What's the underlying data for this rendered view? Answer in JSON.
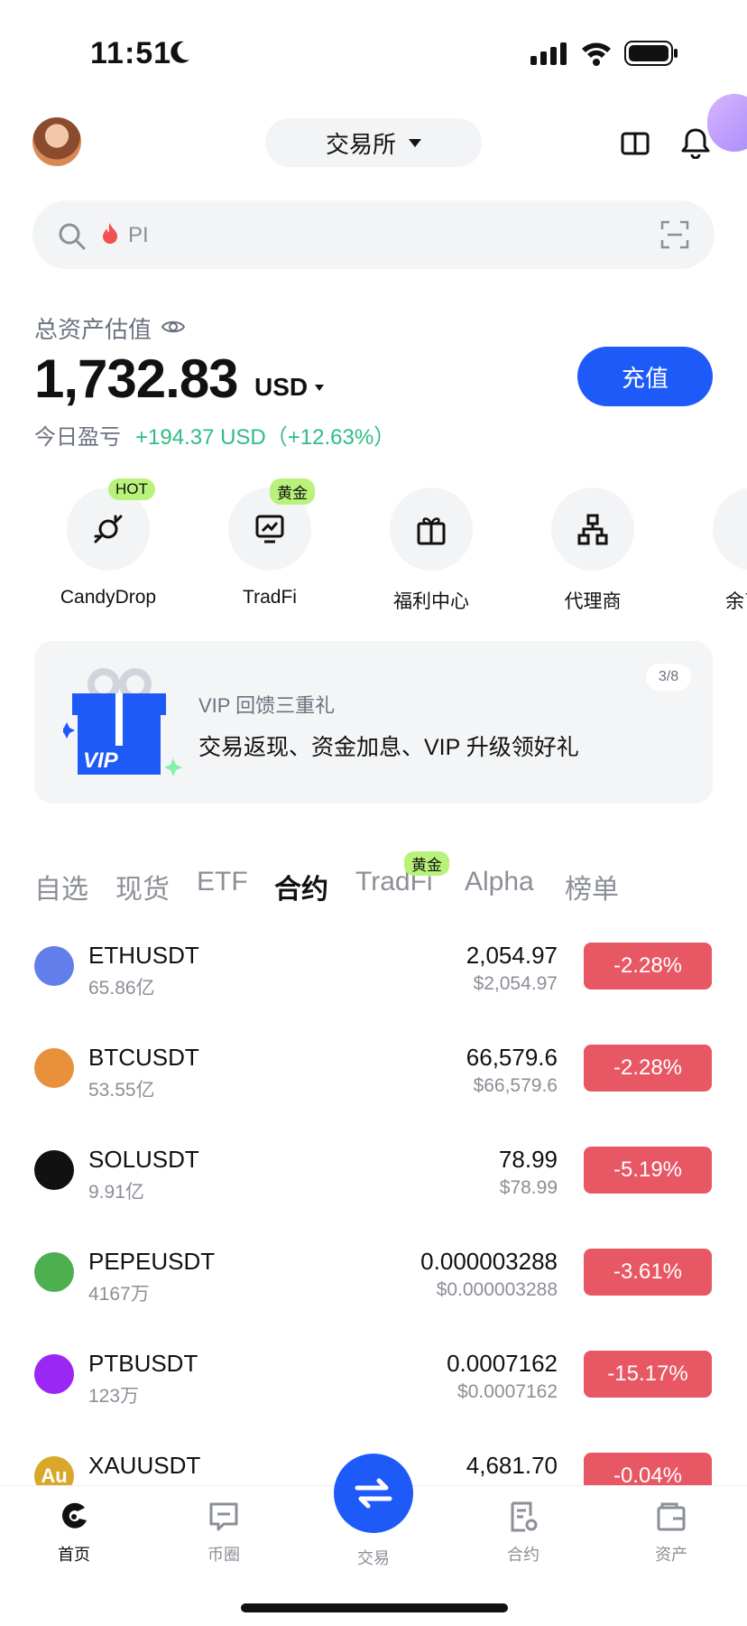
{
  "status": {
    "time": "11:51"
  },
  "header": {
    "exchange_label": "交易所"
  },
  "search": {
    "placeholder": "PI"
  },
  "assets": {
    "label": "总资产估值",
    "value": "1,732.83",
    "unit": "USD",
    "pnl_label": "今日盈亏",
    "pnl_value": "+194.37 USD（+12.63%）",
    "deposit_label": "充值"
  },
  "shortcuts": [
    {
      "label": "CandyDrop",
      "badge": "HOT"
    },
    {
      "label": "TradFi",
      "badge": "黄金"
    },
    {
      "label": "福利中心"
    },
    {
      "label": "代理商"
    },
    {
      "label": "余币"
    }
  ],
  "banner": {
    "subtitle": "VIP 回馈三重礼",
    "title": "交易返现、资金加息、VIP 升级领好礼",
    "page": "3/8",
    "gift_text": "VIP"
  },
  "tabs": [
    {
      "label": "自选"
    },
    {
      "label": "现货"
    },
    {
      "label": "ETF"
    },
    {
      "label": "合约",
      "active": true
    },
    {
      "label": "TradFi",
      "badge": "黄金"
    },
    {
      "label": "Alpha"
    },
    {
      "label": "榜单"
    }
  ],
  "markets": [
    {
      "symbol": "ETHUSDT",
      "volume": "65.86亿",
      "price": "2,054.97",
      "price_usd": "$2,054.97",
      "change": "-2.28%",
      "icon": "eth-icon",
      "color": "#627eea"
    },
    {
      "symbol": "BTCUSDT",
      "volume": "53.55亿",
      "price": "66,579.6",
      "price_usd": "$66,579.6",
      "change": "-2.28%",
      "icon": "btc-icon",
      "color": "#e8913a"
    },
    {
      "symbol": "SOLUSDT",
      "volume": "9.91亿",
      "price": "78.99",
      "price_usd": "$78.99",
      "change": "-5.19%",
      "icon": "sol-icon",
      "color": "#111111"
    },
    {
      "symbol": "PEPEUSDT",
      "volume": "4167万",
      "price": "0.000003288",
      "price_usd": "$0.000003288",
      "change": "-3.61%",
      "icon": "pepe-icon",
      "color": "#4caf50"
    },
    {
      "symbol": "PTBUSDT",
      "volume": "123万",
      "price": "0.0007162",
      "price_usd": "$0.0007162",
      "change": "-15.17%",
      "icon": "ptb-icon",
      "color": "#9b27f5"
    },
    {
      "symbol": "XAUUSDT",
      "volume": "",
      "price": "4,681.70",
      "price_usd": "",
      "change": "-0.04%",
      "icon": "xau-icon",
      "color": "#d9a82a",
      "icon_text": "Au"
    }
  ],
  "nav": {
    "items": [
      {
        "label": "首页",
        "active": true
      },
      {
        "label": "币圈"
      },
      {
        "label": "交易"
      },
      {
        "label": "合约"
      },
      {
        "label": "资产"
      }
    ]
  },
  "colors": {
    "accent": "#1e5af8",
    "down": "#e85764",
    "up": "#2ebd85",
    "badge": "#b9f27a"
  }
}
